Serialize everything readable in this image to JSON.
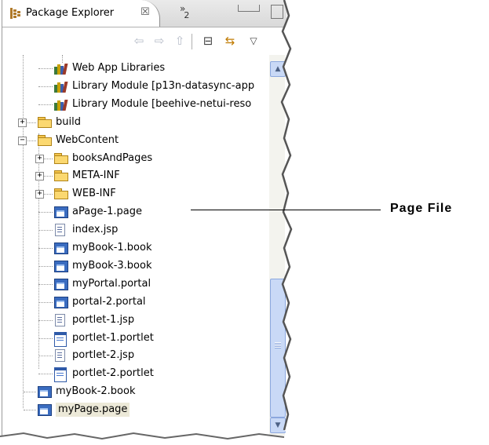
{
  "view": {
    "tab_label": "Package Explorer",
    "tab_close": "☒",
    "tab_overflow": "»",
    "tab_overflow_count": "2"
  },
  "toolbar": {
    "back_icon": "⇦",
    "forward_icon": "⇨",
    "up_icon": "⇧",
    "collapse_icon": "⊟",
    "link_icon": "⇆",
    "menu_icon": "▽"
  },
  "tree": [
    {
      "label": "Web App Libraries",
      "icon": "library-icon",
      "depth": 2
    },
    {
      "label": "Library Module [p13n-datasync-app",
      "icon": "library-icon",
      "depth": 2
    },
    {
      "label": "Library Module [beehive-netui-reso",
      "icon": "library-icon",
      "depth": 2
    },
    {
      "label": "build",
      "icon": "folder-icon",
      "depth": 1,
      "toggle": "+"
    },
    {
      "label": "WebContent",
      "icon": "folder-icon",
      "depth": 1,
      "toggle": "−"
    },
    {
      "label": "booksAndPages",
      "icon": "folder-icon",
      "depth": 2,
      "toggle": "+"
    },
    {
      "label": "META-INF",
      "icon": "folder-icon",
      "depth": 2,
      "toggle": "+"
    },
    {
      "label": "WEB-INF",
      "icon": "folder-icon",
      "depth": 2,
      "toggle": "+"
    },
    {
      "label": "aPage-1.page",
      "icon": "page-icon",
      "depth": 2
    },
    {
      "label": "index.jsp",
      "icon": "jsp-icon",
      "depth": 2
    },
    {
      "label": "myBook-1.book",
      "icon": "page-icon",
      "depth": 2
    },
    {
      "label": "myBook-3.book",
      "icon": "page-icon",
      "depth": 2
    },
    {
      "label": "myPortal.portal",
      "icon": "page-icon",
      "depth": 2
    },
    {
      "label": "portal-2.portal",
      "icon": "page-icon",
      "depth": 2
    },
    {
      "label": "portlet-1.jsp",
      "icon": "jsp-icon",
      "depth": 2
    },
    {
      "label": "portlet-1.portlet",
      "icon": "portlet-icon",
      "depth": 2
    },
    {
      "label": "portlet-2.jsp",
      "icon": "jsp-icon",
      "depth": 2
    },
    {
      "label": "portlet-2.portlet",
      "icon": "portlet-icon",
      "depth": 2
    },
    {
      "label": "myBook-2.book",
      "icon": "page-icon",
      "depth": 1
    },
    {
      "label": "myPage.page",
      "icon": "page-icon",
      "depth": 1,
      "selected": true
    }
  ],
  "scrollbar": {
    "up_arrow": "▲",
    "down_arrow": "▼"
  },
  "callout": {
    "label": "Page File"
  }
}
